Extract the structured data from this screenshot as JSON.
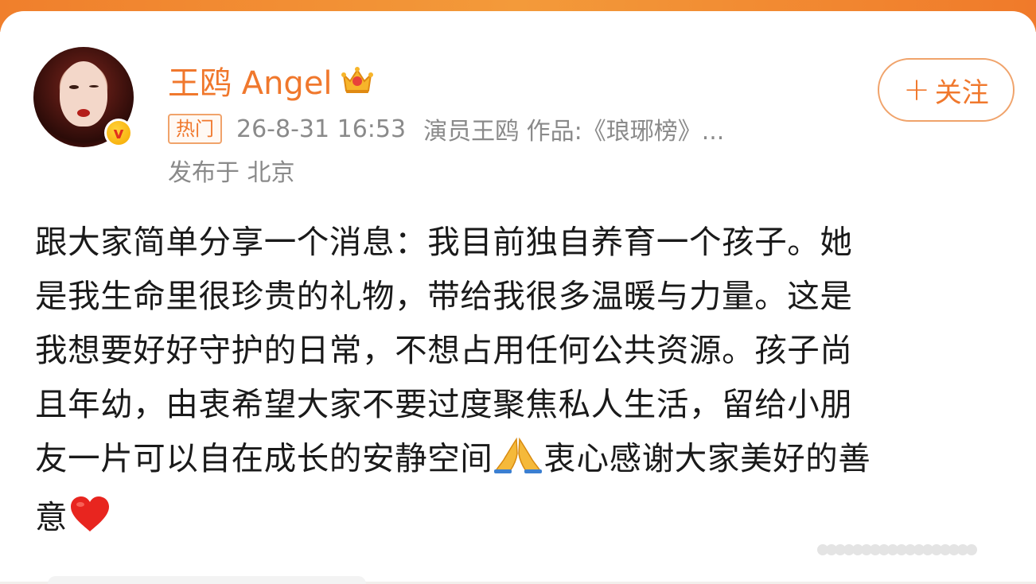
{
  "header": {
    "username": "王鸥 Angel",
    "hot_label": "热门",
    "timestamp": "26-8-31 16:53",
    "source": "演员王鸥 作品:《琅琊榜》...",
    "location": "发布于 北京",
    "follow_plus": "+",
    "follow_label": "关注"
  },
  "post": {
    "lines": [
      "跟大家简单分享一个消息：我目前独自养育一个孩子。她",
      "是我生命里很珍贵的礼物，带给我很多温暖与力量。这是",
      "我想要好好守护的日常，不想占用任何公共资源。孩子尚",
      "且年幼，由衷希望大家不要过度聚焦私人生活，留给小朋",
      "友一片可以自在成长的安静空间",
      "衷心感谢大家美好的善",
      "意"
    ]
  },
  "icons": {
    "verified": "v",
    "crown": "crown-icon",
    "praying_hands": "praying-hands-icon",
    "heart": "red-heart-icon"
  },
  "colors": {
    "accent": "#f0782d",
    "meta_text": "#8a8a8a",
    "body_text": "#1a1a1a"
  }
}
